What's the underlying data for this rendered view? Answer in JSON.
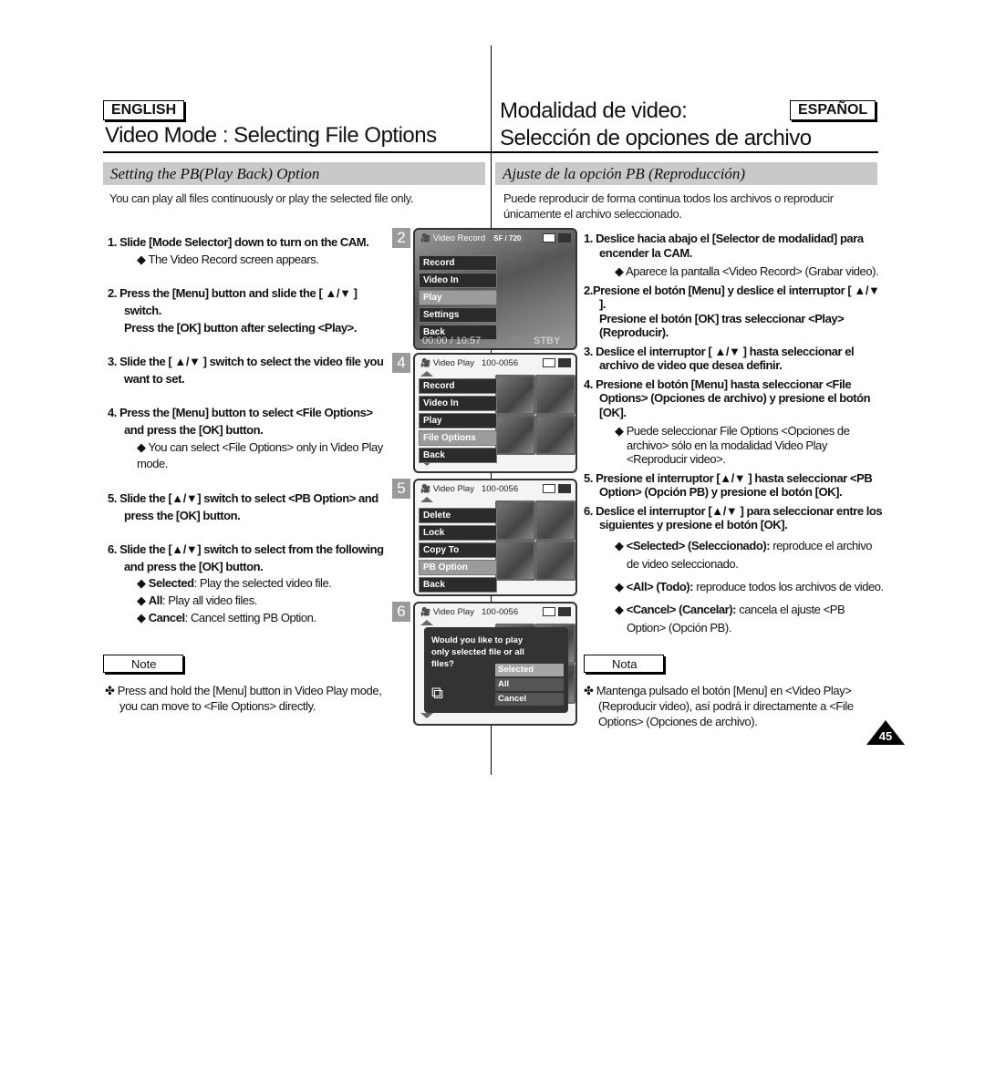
{
  "english": {
    "lang_label": "ENGLISH",
    "title": "Video Mode : Selecting File Options",
    "section": "Setting the PB(Play Back) Option",
    "intro": "You can play all files continuously or play the selected file only.",
    "steps": [
      {
        "text": "1. Slide [Mode Selector] down to turn on the CAM.",
        "subs": [
          "◆ The Video Record screen appears."
        ]
      },
      {
        "text": "2. Press the [Menu] button and slide the [ ▲/▼ ] switch.",
        "extra": "Press the [OK] button after selecting <Play>."
      },
      {
        "text": "3. Slide the [ ▲/▼ ] switch to select the video file you want to set."
      },
      {
        "text": "4. Press the [Menu] button to select <File Options> and press the [OK] button.",
        "subs": [
          "◆ You can select <File Options> only in Video Play mode."
        ]
      },
      {
        "text": "5.  Slide the [▲/▼] switch to select <PB Option> and press the [OK] button."
      },
      {
        "text": "6. Slide the [▲/▼] switch to select from the following and press the [OK] button.",
        "bsubs": [
          {
            "b": "Selected",
            "t": ": Play the selected video file."
          },
          {
            "b": "All",
            "t": ": Play all video files."
          },
          {
            "b": "Cancel",
            "t": ": Cancel setting PB Option."
          }
        ]
      }
    ],
    "note_label": "Note",
    "note_text": "✤ Press and hold the [Menu] button in Video Play mode, you can move to <File Options> directly."
  },
  "spanish": {
    "lang_label": "ESPAÑOL",
    "title_line1": "Modalidad de video:",
    "title_line2": "Selección de opciones de archivo",
    "section": "Ajuste de la opción PB (Reproducción)",
    "intro": "Puede reproducir de forma continua todos los archivos o reproducir únicamente el archivo seleccionado.",
    "steps": [
      {
        "text": "1. Deslice hacia abajo el [Selector de modalidad] para encender la CAM.",
        "subs": [
          "◆ Aparece la pantalla <Video Record> (Grabar video)."
        ]
      },
      {
        "text": "2.Presione el botón [Menu] y deslice el interruptor [ ▲/▼ ].",
        "extra": "Presione el botón [OK] tras seleccionar <Play> (Reproducir)."
      },
      {
        "text": "3. Deslice el interruptor [ ▲/▼ ] hasta seleccionar el archivo de video que desea definir."
      },
      {
        "text": "4. Presione el botón [Menu] hasta seleccionar <File Options> (Opciones de archivo) y presione el botón [OK].",
        "subs": [
          "◆ Puede seleccionar File Options <Opciones de archivo> sólo en la modalidad Video Play <Reproducir video>."
        ]
      },
      {
        "text": "5.  Presione el interruptor [▲/▼ ] hasta seleccionar <PB Option> (Opción PB) y presione el botón [OK]."
      },
      {
        "text": "6. Deslice el interruptor [▲/▼ ] para seleccionar entre los siguientes y presione el botón [OK].",
        "bsubs": [
          {
            "b": "<Selected> (Seleccionado):",
            "t": " reproduce el archivo de video seleccionado."
          },
          {
            "b": "<All> (Todo):",
            "t": " reproduce todos los archivos de  video."
          },
          {
            "b": "<Cancel> (Cancelar):",
            "t": " cancela el ajuste <PB Option> (Opción PB)."
          }
        ]
      }
    ],
    "note_label": "Nota",
    "note_text": "✤ Mantenga pulsado el botón [Menu] en <Video Play> (Reproducir video), así podrá ir directamente a <File Options> (Opciones de archivo)."
  },
  "screens": [
    {
      "badge": "2",
      "header": "Video Record",
      "quality": "SF / 720",
      "menu": [
        "Record",
        "Video In",
        "Play",
        "Settings",
        "Back"
      ],
      "selected": 2,
      "time": "00:00 / 10:57",
      "status": "STBY"
    },
    {
      "badge": "4",
      "header": "Video Play",
      "file": "100-0056",
      "menu": [
        "Record",
        "Video In",
        "Play",
        "File Options",
        "Back"
      ],
      "selected": 3
    },
    {
      "badge": "5",
      "header": "Video Play",
      "file": "100-0056",
      "menu": [
        "Delete",
        "Lock",
        "Copy To",
        "PB Option",
        "Back"
      ],
      "selected": 3
    },
    {
      "badge": "6",
      "header": "Video Play",
      "file": "100-0056",
      "dialog": "Would you like to play only selected file or all files?",
      "options": [
        "Selected",
        "All",
        "Cancel"
      ],
      "selected": 0
    }
  ],
  "page_number": "45",
  "icons": {
    "camcorder": "camcorder-icon",
    "battery": "battery-icon",
    "memory": "memory-card-icon",
    "copy": "copy-files-icon"
  }
}
